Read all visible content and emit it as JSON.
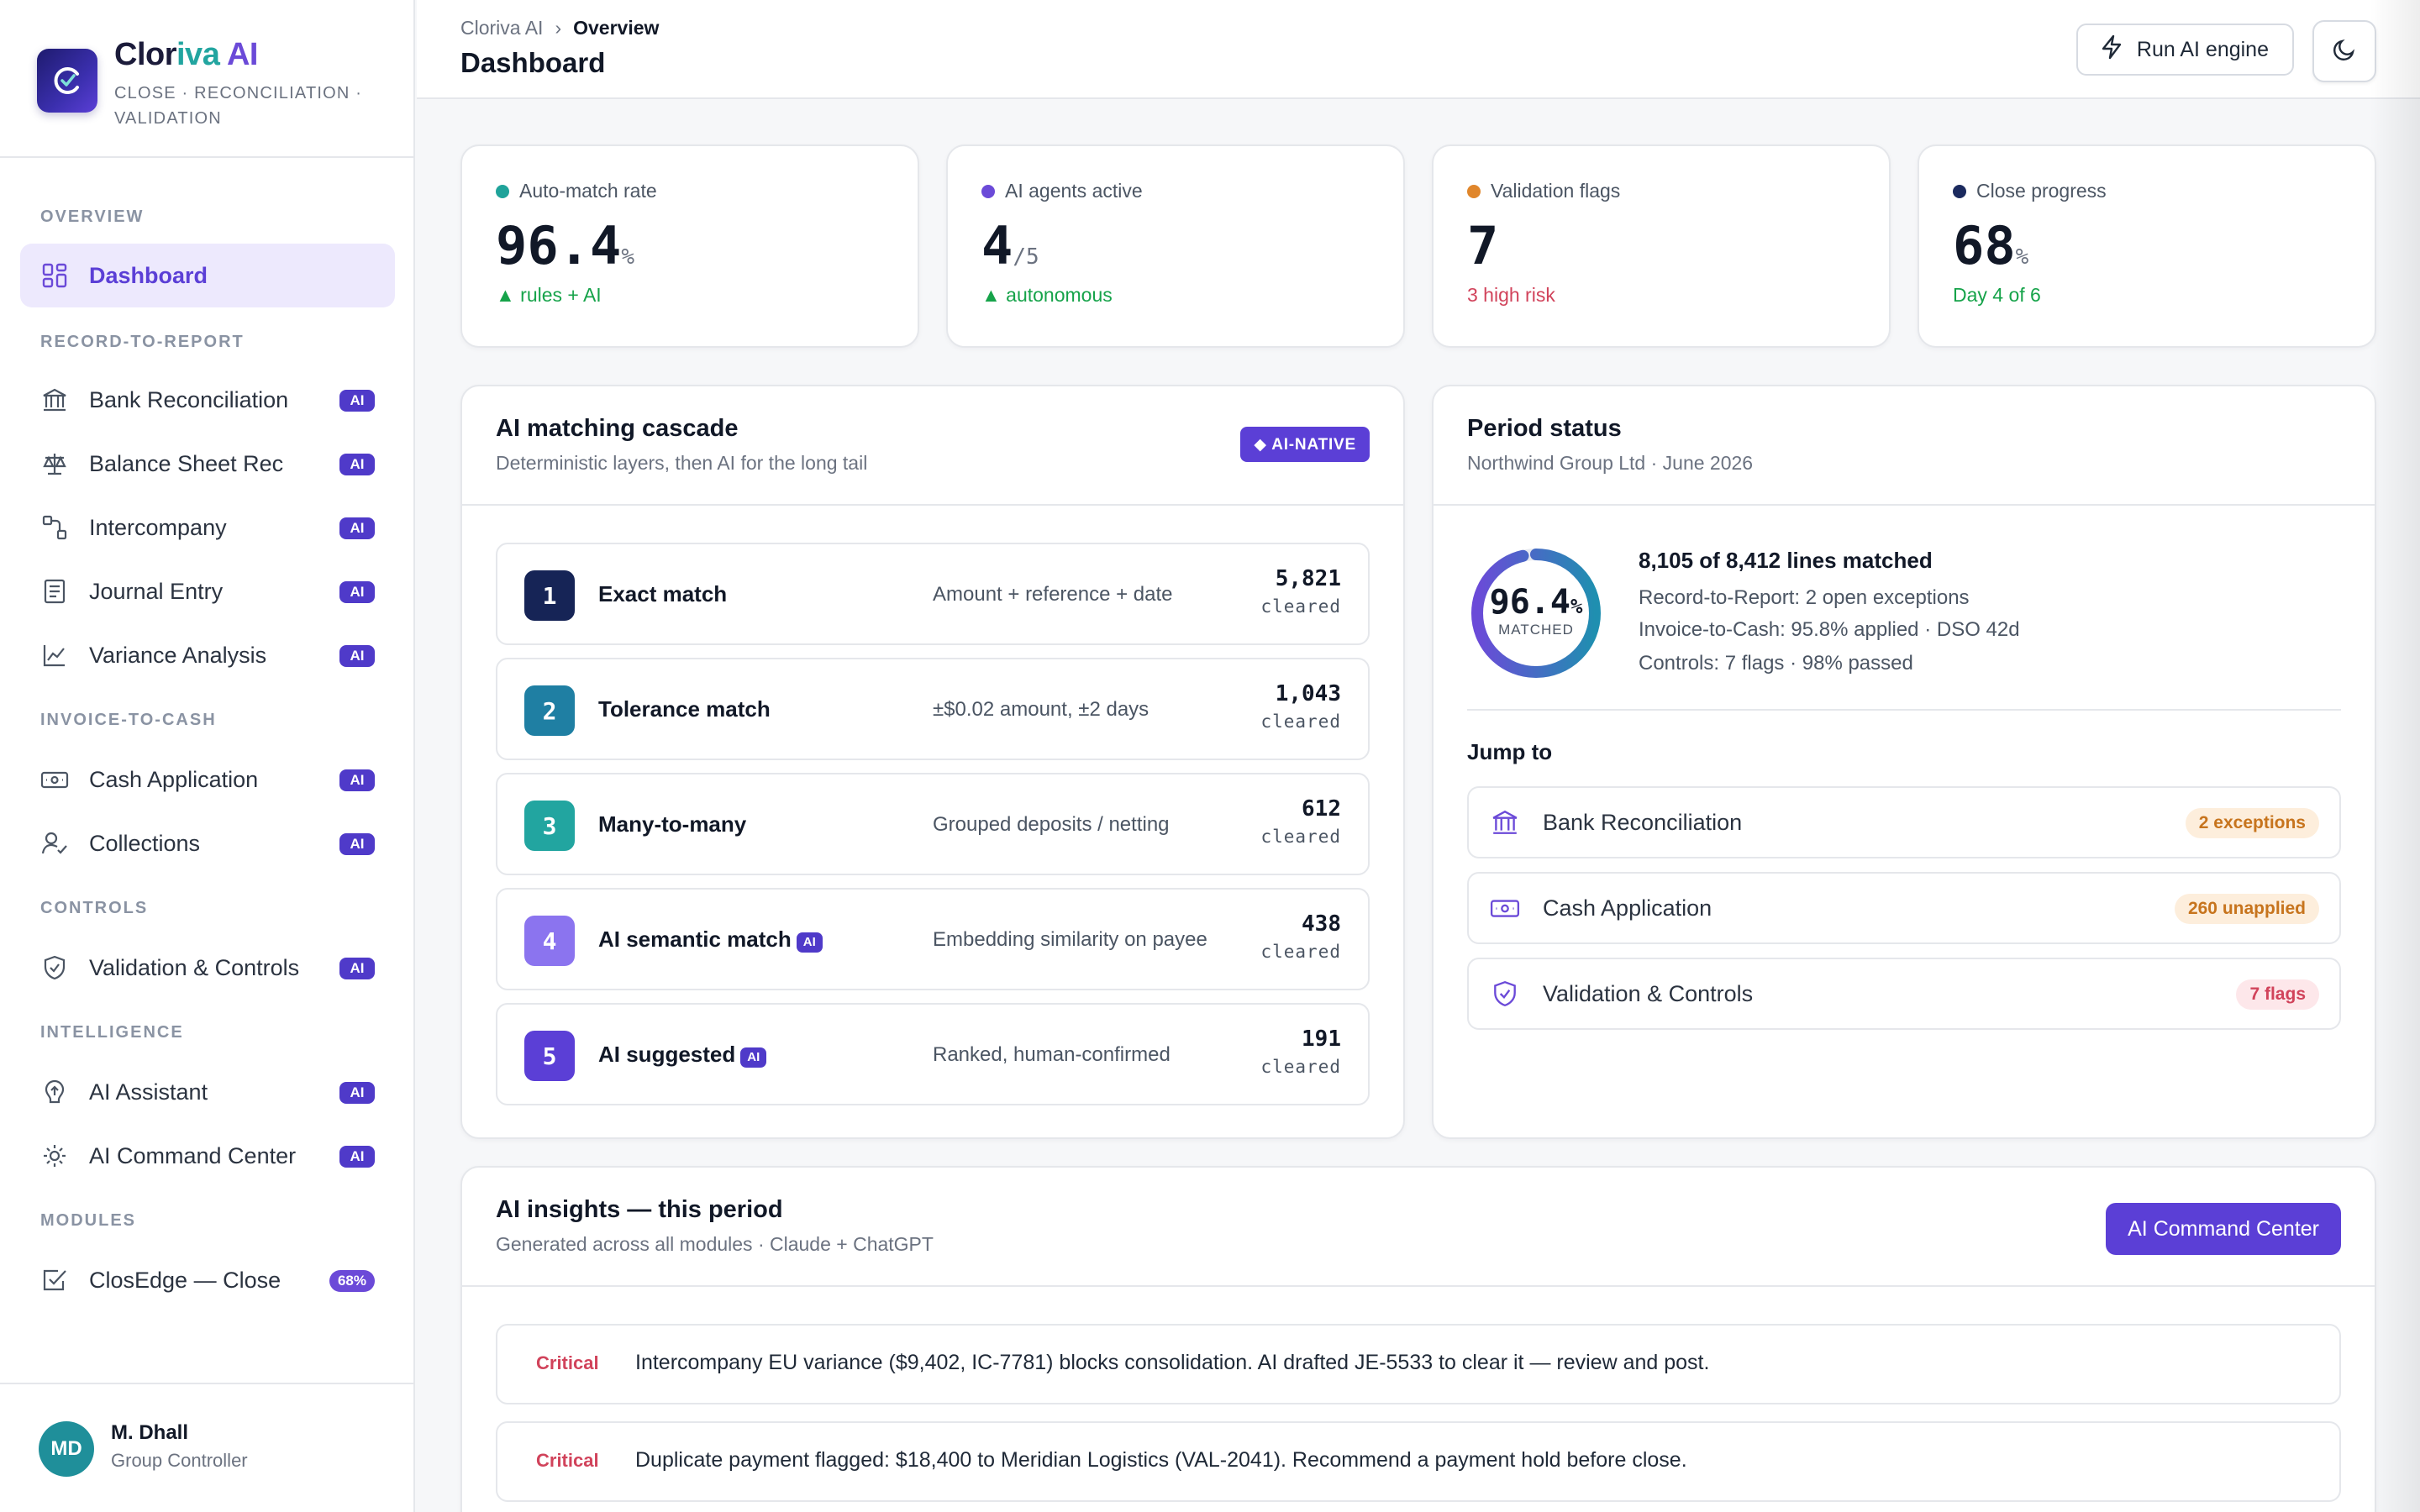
{
  "brand": {
    "name_part1": "Clor",
    "name_part2": "iva",
    "name_part3": " AI",
    "tagline": "CLOSE · RECONCILIATION · VALIDATION"
  },
  "sidebar": {
    "sections": {
      "overview": "OVERVIEW",
      "r2r": "RECORD-TO-REPORT",
      "i2c": "INVOICE-TO-CASH",
      "controls": "CONTROLS",
      "intelligence": "INTELLIGENCE",
      "modules": "MODULES"
    },
    "items": [
      {
        "label": "Dashboard",
        "icon": "dashboard-icon",
        "active": true
      },
      {
        "label": "Bank Reconciliation",
        "icon": "bank-icon",
        "badge": "AI"
      },
      {
        "label": "Balance Sheet Rec",
        "icon": "scale-icon",
        "badge": "AI"
      },
      {
        "label": "Intercompany",
        "icon": "intercompany-icon",
        "badge": "AI"
      },
      {
        "label": "Journal Entry",
        "icon": "journal-icon",
        "badge": "AI"
      },
      {
        "label": "Variance Analysis",
        "icon": "chart-line-icon",
        "badge": "AI"
      },
      {
        "label": "Cash Application",
        "icon": "cash-icon",
        "badge": "AI"
      },
      {
        "label": "Collections",
        "icon": "collections-icon",
        "badge": "AI"
      },
      {
        "label": "Validation & Controls",
        "icon": "shield-check-icon",
        "badge": "AI"
      },
      {
        "label": "AI Assistant",
        "icon": "ai-assistant-icon",
        "badge": "AI"
      },
      {
        "label": "AI Command Center",
        "icon": "sun-gear-icon",
        "badge": "AI"
      },
      {
        "label": "ClosEdge — Close",
        "icon": "checkbox-icon",
        "badge": "68%"
      }
    ]
  },
  "user": {
    "initials": "MD",
    "name": "M. Dhall",
    "role": "Group Controller"
  },
  "header": {
    "breadcrumb_root": "Cloriva AI",
    "breadcrumb_sep": "›",
    "breadcrumb_current": "Overview",
    "title": "Dashboard",
    "run_button": "Run AI engine"
  },
  "kpis": [
    {
      "label": "Auto-match rate",
      "value": "96.4",
      "unit": "%",
      "sub": "▲ rules + AI",
      "dot": "#1fa39a",
      "sub_color": "#16a34a"
    },
    {
      "label": "AI agents active",
      "value": "4",
      "unit": "/5",
      "sub": "▲ autonomous",
      "dot": "#6b4ad8",
      "sub_color": "#16a34a"
    },
    {
      "label": "Validation flags",
      "value": "7",
      "unit": "",
      "sub": "3 high risk",
      "dot": "#e0862b",
      "sub_color": "#d1435b"
    },
    {
      "label": "Close progress",
      "value": "68",
      "unit": "%",
      "sub": "Day 4 of 6",
      "dot": "#1b2a5e",
      "sub_color": "#16a34a"
    }
  ],
  "cascade": {
    "title": "AI matching cascade",
    "subtitle": "Deterministic layers, then AI for the long tail",
    "badge": "◆ AI-NATIVE",
    "cleared_label": "cleared",
    "steps": [
      {
        "num": "1",
        "name": "Exact match",
        "desc": "Amount + reference + date",
        "count": "5,821",
        "color": "#162456",
        "ai": false
      },
      {
        "num": "2",
        "name": "Tolerance match",
        "desc": "±$0.02 amount, ±2 days",
        "count": "1,043",
        "color": "#1f7fa3",
        "ai": false
      },
      {
        "num": "3",
        "name": "Many-to-many",
        "desc": "Grouped deposits / netting",
        "count": "612",
        "color": "#22a5a0",
        "ai": false
      },
      {
        "num": "4",
        "name": "AI semantic match",
        "desc": "Embedding similarity on payee",
        "count": "438",
        "color": "#8b74ef",
        "ai": true
      },
      {
        "num": "5",
        "name": "AI suggested",
        "desc": "Ranked, human-confirmed",
        "count": "191",
        "color": "#5b3fd6",
        "ai": true
      }
    ],
    "ai_tag": "AI"
  },
  "period": {
    "title": "Period status",
    "subtitle": "Northwind Group Ltd · June 2026",
    "donut_value": "96.4",
    "donut_unit": "%",
    "donut_fraction": 0.964,
    "donut_label": "MATCHED",
    "headline": "8,105 of 8,412 lines matched",
    "lines": [
      "Record-to-Report: 2 open exceptions",
      "Invoice-to-Cash: 95.8% applied · DSO 42d",
      "Controls: 7 flags · 98% passed"
    ],
    "jump_title": "Jump to",
    "jumps": [
      {
        "label": "Bank Reconciliation",
        "icon": "bank-icon",
        "badge": "2 exceptions",
        "tone": "amber"
      },
      {
        "label": "Cash Application",
        "icon": "cash-icon",
        "badge": "260 unapplied",
        "tone": "amber"
      },
      {
        "label": "Validation & Controls",
        "icon": "shield-check-icon",
        "badge": "7 flags",
        "tone": "red"
      }
    ]
  },
  "insights": {
    "title": "AI insights — this period",
    "subtitle": "Generated across all modules · Claude + ChatGPT",
    "button": "AI Command Center",
    "items": [
      {
        "severity": "Critical",
        "text": "Intercompany EU variance ($9,402, IC-7781) blocks consolidation. AI drafted JE-5533 to clear it — review and post."
      },
      {
        "severity": "Critical",
        "text": "Duplicate payment flagged: $18,400 to Meridian Logistics (VAL-2041). Recommend a payment hold before close."
      }
    ]
  },
  "colors": {
    "accent": "#5b3fd6",
    "accent_light": "#ede9fd",
    "donut_start": "#6b4ad8",
    "donut_end": "#1f8fb0"
  }
}
